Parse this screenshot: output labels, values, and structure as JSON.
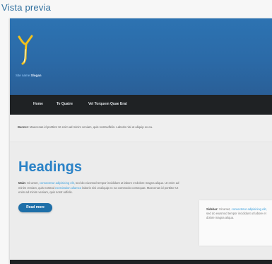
{
  "window": {
    "title": "Vista previa"
  },
  "header": {
    "site_name": "Site name",
    "slogan": "Slogan"
  },
  "nav": {
    "items": [
      "Home",
      "Te Quatre",
      "Vel Torquem Quae Erat"
    ]
  },
  "banner": {
    "label": "Banner:",
    "text": "Maecenas id porttitor Ut enim ad minim veniam, quis nostrudfelis. Laboris nisi ut aliquip ex ea."
  },
  "main": {
    "heading": "Headings",
    "body_label": "Main:",
    "body_text_1": "Sit amet,",
    "body_link_1": "consectetur adipisicing elit,",
    "body_text_2": "sed do eiusmod tempor incididunt ut labore et dolore magna aliqua. Ut enim ad minim veniam, quis nostrud",
    "body_link_2": "exercitation ullamco",
    "body_text_3": "laboris nisi ut aliquip ex ea commodo consequat. Maecenas id porttitor Ut enim ad minim veniam, quis nostr udfelis.",
    "read_more": "Read more"
  },
  "sidebar": {
    "label": "Sidebar:",
    "text_1": "Sit amet,",
    "link": "consectetur adipisicing elit,",
    "text_2": "sed do eiusmod tempor incididunt ut labore et dolore magna aliqua."
  },
  "colors": {
    "accent": "#2a82c7",
    "header_blue": "#2b6aa7",
    "nav_dark": "#1f2224",
    "button": "#1e6fa8"
  }
}
